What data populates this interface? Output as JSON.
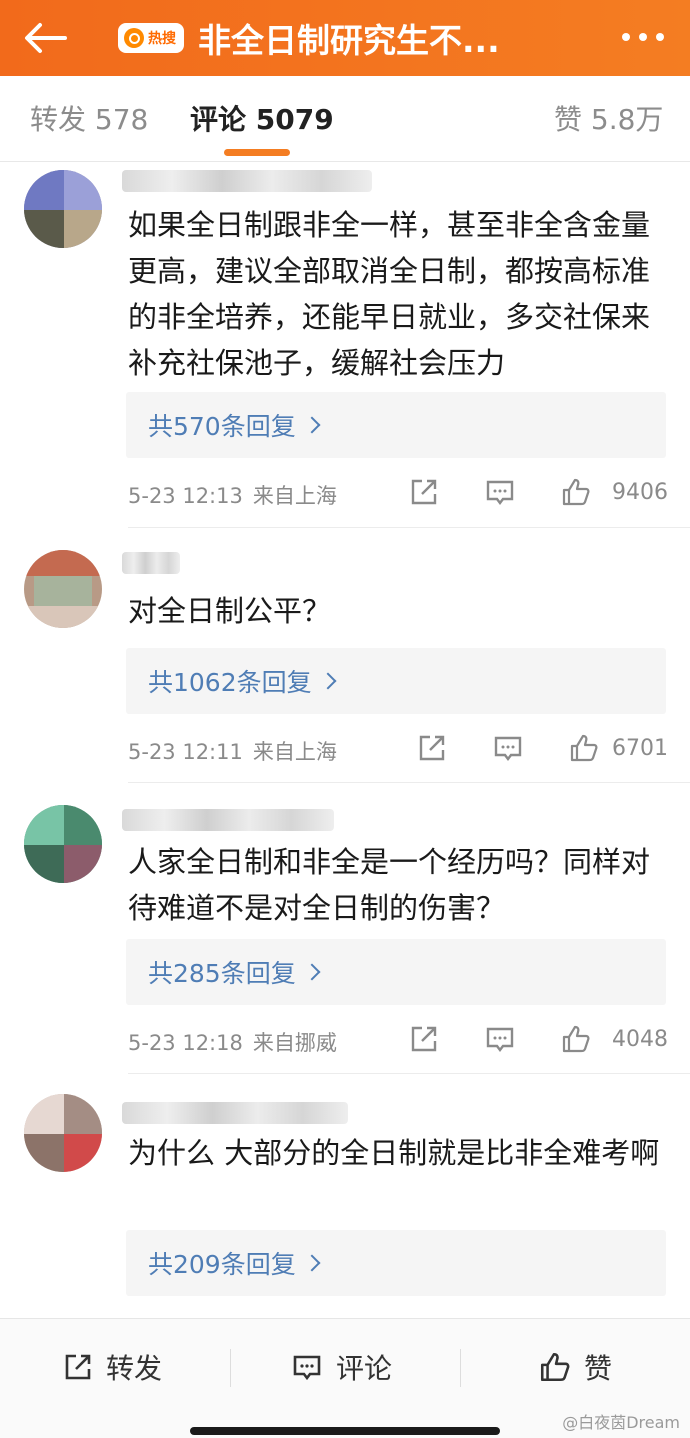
{
  "header": {
    "badge_label": "热搜",
    "title": "非全日制研究生不..."
  },
  "tabs": {
    "repost": "转发 578",
    "comments": "评论 5079",
    "likes": "赞 5.8万"
  },
  "comments": [
    {
      "text": "如果全日制跟非全一样，甚至非全含金量更高，建议全部取消全日制，都按高标准的非全培养，还能早日就业，多交社保来补充社保池子，缓解社会压力",
      "replies": "共570条回复",
      "time": "5-23 12:13",
      "location": "来自上海",
      "likes": "9406"
    },
    {
      "text": "对全日制公平？",
      "replies": "共1062条回复",
      "time": "5-23 12:11",
      "location": "来自上海",
      "likes": "6701"
    },
    {
      "text": "人家全日制和非全是一个经历吗？同样对待难道不是对全日制的伤害？",
      "replies": "共285条回复",
      "time": "5-23 12:18",
      "location": "来自挪威",
      "likes": "4048"
    },
    {
      "text": "为什么 大部分的全日制就是比非全难考啊",
      "replies": "共209条回复"
    }
  ],
  "bottom_bar": {
    "repost": "转发",
    "comment": "评论",
    "like": "赞"
  },
  "watermark": "@白夜茵Dream",
  "colors": {
    "header": "#f47d22",
    "link": "#4f7db5",
    "tab_indicator": "#f47d22"
  }
}
